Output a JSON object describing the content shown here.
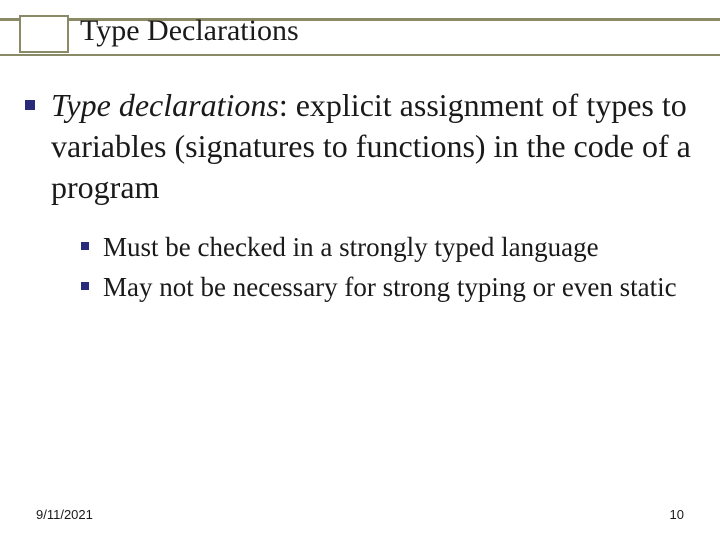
{
  "title": "Type Declarations",
  "main": {
    "term": "Type declarations",
    "definition": ": explicit assignment of types to variables (signatures to functions) in the code of a program"
  },
  "sub_items": [
    "Must be checked in a strongly typed language",
    "May not be necessary for strong typing or even static"
  ],
  "footer": {
    "date": "9/11/2021",
    "page": "10"
  }
}
